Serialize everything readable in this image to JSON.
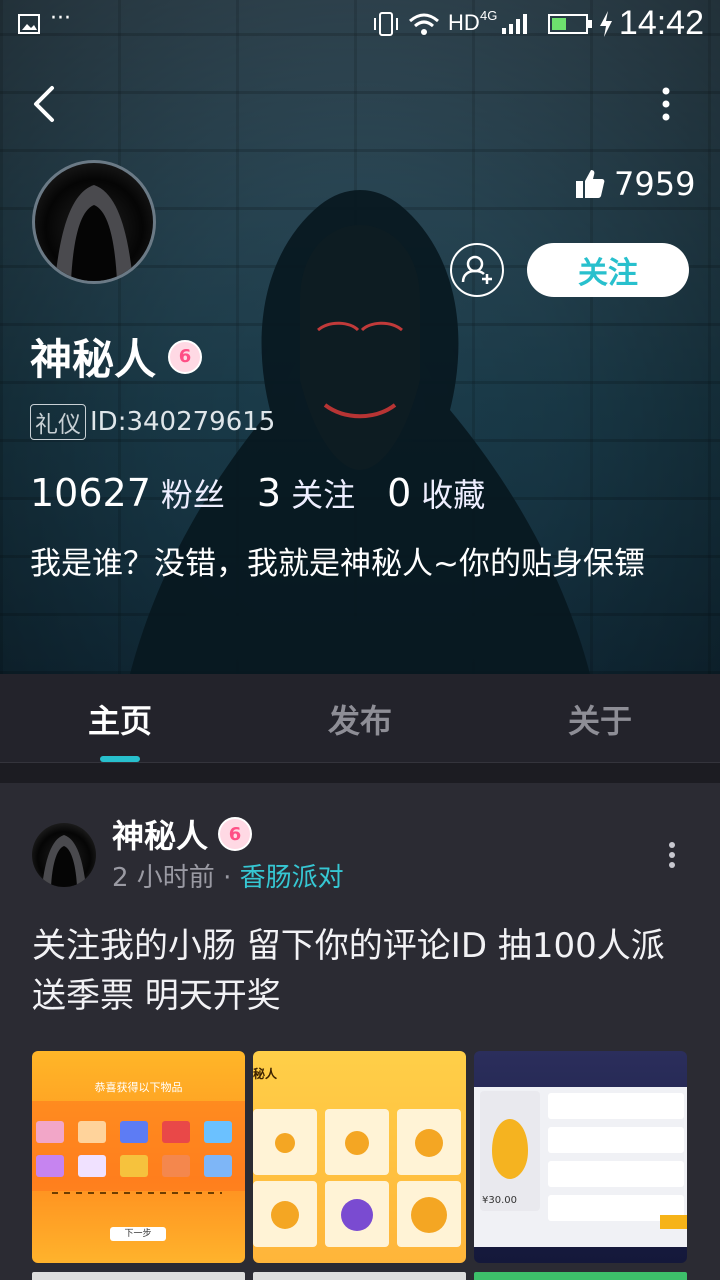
{
  "status_bar": {
    "time": "14:42",
    "network": "HD",
    "signal": "4G"
  },
  "profile": {
    "name": "神秘人",
    "level_badge": "6",
    "tag": "礼仪",
    "id_text": "ID:340279615",
    "likes": "7959",
    "follow_label": "关注",
    "followers_count": "10627",
    "followers_label": "粉丝",
    "following_count": "3",
    "following_label": "关注",
    "favorites_count": "0",
    "favorites_label": "收藏",
    "bio": "我是谁？没错，我就是神秘人~你的贴身保镖"
  },
  "tabs": [
    {
      "label": "主页"
    },
    {
      "label": "发布"
    },
    {
      "label": "关于"
    }
  ],
  "post": {
    "author": "神秘人",
    "level_badge": "6",
    "time": "2 小时前",
    "separator": "·",
    "game": "香肠派对",
    "text": "关注我的小肠 留下你的评论ID 抽100人派送季票 明天开奖",
    "thumb1_title": "恭喜获得以下物品",
    "thumb1_button": "下一步",
    "thumb2_title": "秘人",
    "thumb3_price": "¥30.00"
  },
  "colors": {
    "accent": "#28c0cd",
    "background": "#23232b",
    "card": "#2b2b33"
  }
}
